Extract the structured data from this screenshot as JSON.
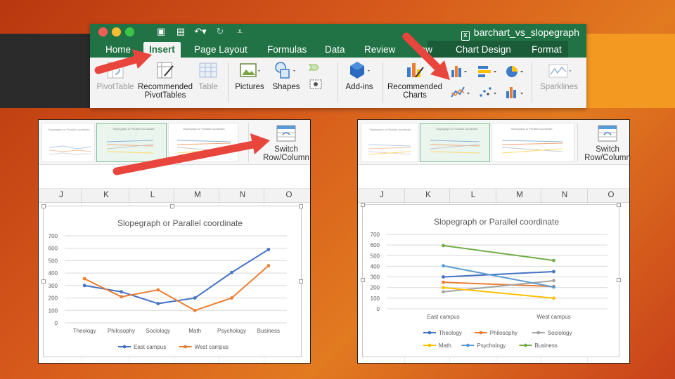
{
  "window": {
    "title": "barchart_vs_slopegraph"
  },
  "tabs": [
    {
      "label": "Home"
    },
    {
      "label": "Insert"
    },
    {
      "label": "Page Layout"
    },
    {
      "label": "Formulas"
    },
    {
      "label": "Data"
    },
    {
      "label": "Review"
    },
    {
      "label": "View"
    },
    {
      "label": "Chart Design"
    },
    {
      "label": "Format"
    }
  ],
  "ribbon": {
    "pivot_table": "PivotTable",
    "recommended_pivot_line1": "Recommended",
    "recommended_pivot_line2": "PivotTables",
    "table": "Table",
    "pictures": "Pictures",
    "shapes": "Shapes",
    "addins": "Add-ins",
    "recommended_charts_line1": "Recommended",
    "recommended_charts_line2": "Charts",
    "sparklines": "Sparklines"
  },
  "switch_button": {
    "line1": "Switch",
    "line2": "Row/Column"
  },
  "columns_left": [
    "J",
    "K",
    "L",
    "M",
    "N",
    "O"
  ],
  "columns_right": [
    "J",
    "K",
    "L",
    "M",
    "N",
    "O"
  ],
  "thumbnails": {
    "left": [
      "Slopegraph or Parallel coordinate",
      "Slopegraph or Parallel coordinate",
      "Slopegraph or Parallel coordinate"
    ],
    "right": [
      "Slopegraph or Parallel coordinate",
      "Slopegraph or Parallel coordinate",
      "Slopegraph or Parallel coordinate"
    ]
  },
  "colors": {
    "accent_green": "#217346",
    "arrow_red": "#e8453c",
    "blue": "#4472c4",
    "orange": "#ed7d31",
    "gray": "#a5a5a5",
    "yellow": "#ffc000",
    "light_blue": "#5b9bd5",
    "green": "#70ad47"
  },
  "chart_data": [
    {
      "type": "line",
      "title": "Slopegraph or Parallel coordinate",
      "categories": [
        "Theology",
        "Philosophy",
        "Sociology",
        "Math",
        "Psychology",
        "Business"
      ],
      "ylim": [
        0,
        700
      ],
      "yticks": [
        0,
        100,
        200,
        300,
        400,
        500,
        600,
        700
      ],
      "grid": true,
      "legend": "bottom",
      "series": [
        {
          "name": "East campus",
          "color": "#4472c4",
          "values": [
            300,
            250,
            155,
            200,
            405,
            590
          ]
        },
        {
          "name": "West campus",
          "color": "#ed7d31",
          "values": [
            355,
            210,
            265,
            100,
            200,
            460
          ]
        }
      ]
    },
    {
      "type": "line",
      "title": "Slopegraph or Parallel coordinate",
      "categories": [
        "East campus",
        "West campus"
      ],
      "ylim": [
        0,
        700
      ],
      "yticks": [
        0,
        100,
        200,
        300,
        400,
        500,
        600,
        700
      ],
      "grid": true,
      "legend": "bottom",
      "series": [
        {
          "name": "Theology",
          "color": "#4472c4",
          "values": [
            300,
            350
          ]
        },
        {
          "name": "Philosophy",
          "color": "#ed7d31",
          "values": [
            250,
            210
          ]
        },
        {
          "name": "Sociology",
          "color": "#a5a5a5",
          "values": [
            160,
            265
          ]
        },
        {
          "name": "Math",
          "color": "#ffc000",
          "values": [
            200,
            100
          ]
        },
        {
          "name": "Psychology",
          "color": "#5b9bd5",
          "values": [
            405,
            205
          ]
        },
        {
          "name": "Business",
          "color": "#70ad47",
          "values": [
            595,
            455
          ]
        }
      ]
    }
  ]
}
